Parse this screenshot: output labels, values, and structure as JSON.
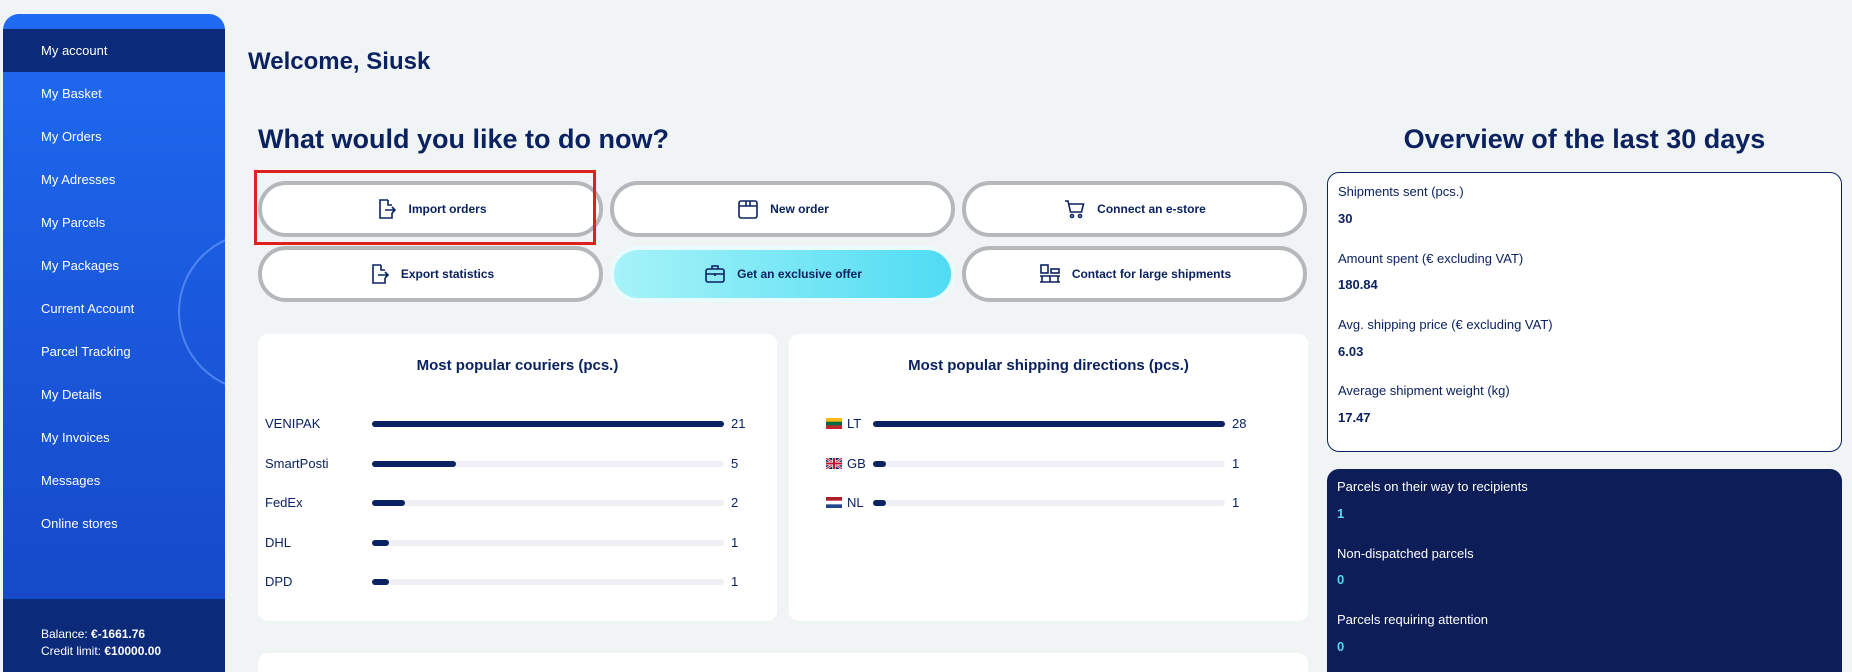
{
  "sidebar": {
    "items": [
      {
        "label": "My account",
        "active": true
      },
      {
        "label": "My Basket"
      },
      {
        "label": "My Orders"
      },
      {
        "label": "My Adresses"
      },
      {
        "label": "My Parcels"
      },
      {
        "label": "My Packages"
      },
      {
        "label": "Current Account"
      },
      {
        "label": "Parcel Tracking"
      },
      {
        "label": "My Details"
      },
      {
        "label": "My Invoices"
      },
      {
        "label": "Messages"
      },
      {
        "label": "Online stores"
      }
    ],
    "balance_label": "Balance:",
    "balance_value": "€-1661.76",
    "credit_label": "Credit limit:",
    "credit_value": "€10000.00"
  },
  "welcome": "Welcome, Siusk",
  "actions_title": "What would you like to do now?",
  "actions": {
    "import_orders": "Import orders",
    "new_order": "New order",
    "connect_estore": "Connect an e-store",
    "export_statistics": "Export statistics",
    "exclusive_offer": "Get an exclusive offer",
    "large_shipments": "Contact for large shipments"
  },
  "couriers": {
    "title": "Most popular couriers (pcs.)",
    "rows": [
      {
        "label": "VENIPAK",
        "value": 21
      },
      {
        "label": "SmartPosti",
        "value": 5
      },
      {
        "label": "FedEx",
        "value": 2
      },
      {
        "label": "DHL",
        "value": 1
      },
      {
        "label": "DPD",
        "value": 1
      }
    ]
  },
  "directions": {
    "title": "Most popular shipping directions (pcs.)",
    "rows": [
      {
        "label": "LT",
        "value": 28,
        "flag": "lt-flag-icon"
      },
      {
        "label": "GB",
        "value": 1,
        "flag": "gb-flag-icon"
      },
      {
        "label": "NL",
        "value": 1,
        "flag": "nl-flag-icon"
      }
    ]
  },
  "overview": {
    "title": "Overview of the last 30 days",
    "stats": [
      {
        "label": "Shipments sent (pcs.)",
        "value": "30"
      },
      {
        "label": "Amount spent (€ excluding VAT)",
        "value": "180.84"
      },
      {
        "label": "Avg. shipping price (€ excluding VAT)",
        "value": "6.03"
      },
      {
        "label": "Average shipment weight (kg)",
        "value": "17.47"
      }
    ],
    "status": [
      {
        "label": "Parcels on their way to recipients",
        "value": "1"
      },
      {
        "label": "Non-dispatched parcels",
        "value": "0"
      },
      {
        "label": "Parcels requiring attention",
        "value": "0"
      }
    ]
  },
  "colors": {
    "navy": "#0b2260",
    "sidebar_blue": "#1f6bf2",
    "accent_cyan": "#4fdcf3",
    "highlight_red": "#e0201c"
  }
}
